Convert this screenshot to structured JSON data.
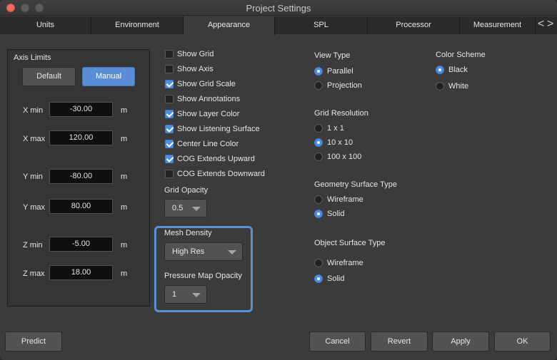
{
  "window": {
    "title": "Project Settings"
  },
  "tabs": [
    {
      "label": "Units"
    },
    {
      "label": "Environment"
    },
    {
      "label": "Appearance",
      "active": true
    },
    {
      "label": "SPL"
    },
    {
      "label": "Processor"
    },
    {
      "label": "Measurement"
    }
  ],
  "tab_scroll": {
    "left": "<",
    "right": ">"
  },
  "axis_limits": {
    "title": "Axis Limits",
    "default_label": "Default",
    "manual_label": "Manual",
    "unit": "m",
    "rows": [
      {
        "label": "X min",
        "value": "-30.00"
      },
      {
        "label": "X max",
        "value": "120.00"
      },
      {
        "label": "Y min",
        "value": "-80.00"
      },
      {
        "label": "Y max",
        "value": "80.00"
      },
      {
        "label": "Z min",
        "value": "-5.00"
      },
      {
        "label": "Z max",
        "value": "18.00"
      }
    ]
  },
  "options": [
    {
      "label": "Show Grid",
      "checked": false
    },
    {
      "label": "Show Axis",
      "checked": false
    },
    {
      "label": "Show Grid Scale",
      "checked": true
    },
    {
      "label": "Show Annotations",
      "checked": false
    },
    {
      "label": "Show Layer Color",
      "checked": true
    },
    {
      "label": "Show Listening Surface",
      "checked": true
    },
    {
      "label": "Center Line Color",
      "checked": true
    },
    {
      "label": "COG Extends Upward",
      "checked": true
    },
    {
      "label": "COG Extends Downward",
      "checked": false
    }
  ],
  "grid_opacity": {
    "label": "Grid Opacity",
    "value": "0.5"
  },
  "mesh_density": {
    "label": "Mesh Density",
    "value": "High Res"
  },
  "pressure_map_opacity": {
    "label": "Pressure Map Opacity",
    "value": "1"
  },
  "view_type": {
    "label": "View Type",
    "options": [
      {
        "label": "Parallel",
        "selected": true
      },
      {
        "label": "Projection",
        "selected": false
      }
    ]
  },
  "color_scheme": {
    "label": "Color Scheme",
    "options": [
      {
        "label": "Black",
        "selected": true
      },
      {
        "label": "White",
        "selected": false
      }
    ]
  },
  "grid_resolution": {
    "label": "Grid Resolution",
    "options": [
      {
        "label": "1 x 1",
        "selected": false
      },
      {
        "label": "10 x 10",
        "selected": true
      },
      {
        "label": "100 x 100",
        "selected": false
      }
    ]
  },
  "geometry_surface_type": {
    "label": "Geometry Surface Type",
    "options": [
      {
        "label": "Wireframe",
        "selected": false
      },
      {
        "label": "Solid",
        "selected": true
      }
    ]
  },
  "object_surface_type": {
    "label": "Object Surface Type",
    "options": [
      {
        "label": "Wireframe",
        "selected": false
      },
      {
        "label": "Solid",
        "selected": true
      }
    ]
  },
  "footer": {
    "predict": "Predict",
    "cancel": "Cancel",
    "revert": "Revert",
    "apply": "Apply",
    "ok": "OK"
  },
  "colors": {
    "accent": "#5a8fd8",
    "close_button": "#ed6a5e",
    "background": "#3b3b3b"
  }
}
